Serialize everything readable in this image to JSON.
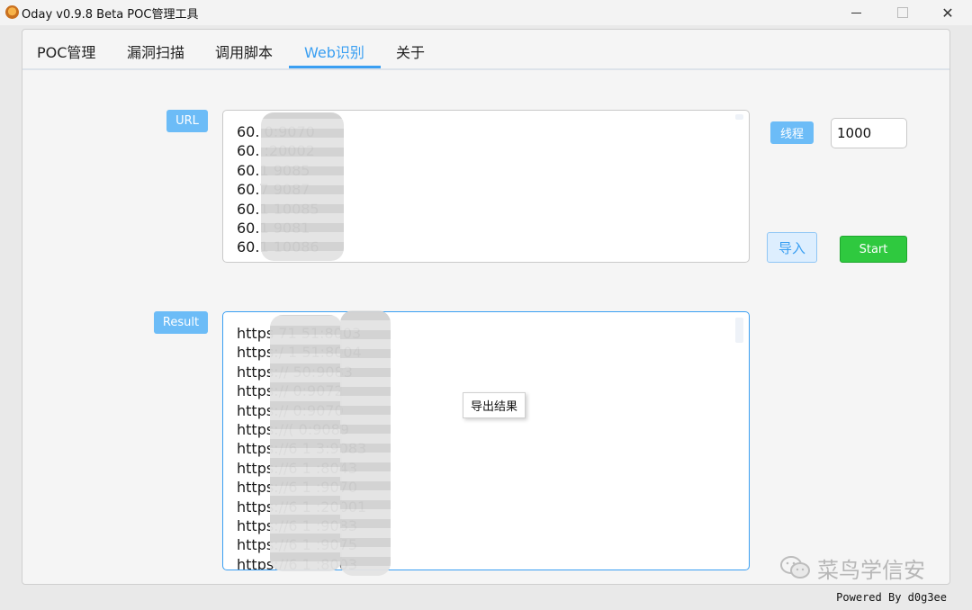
{
  "window": {
    "title": "Oday v0.9.8 Beta POC管理工具"
  },
  "tabs": [
    {
      "label": "POC管理"
    },
    {
      "label": "漏洞扫描"
    },
    {
      "label": "调用脚本"
    },
    {
      "label": "Web识别"
    },
    {
      "label": "关于"
    }
  ],
  "active_tab": "Web识别",
  "url_section": {
    "label": "URL",
    "lines": [
      "60.   0:9070",
      "60.   :20002",
      "60.1   9085",
      "60.7   9087",
      "60.1   10085",
      "60.1   9081",
      "60.1   10086"
    ]
  },
  "thread": {
    "label": "线程",
    "value": "1000"
  },
  "import_label": "导入",
  "start_label": "Start",
  "result_section": {
    "label": "Result",
    "lines": [
      "https   71   51:8003",
      "https:/   1   51:8004",
      "https://   50:9083",
      "https://   0:9072",
      "https://   0:9070",
      "https://(   0:9089",
      "https://6   1   3:9083",
      "https://6   1   :8043",
      "https://6   1   :9070",
      "https://6   1   :20001",
      "https://6   1   :9083",
      "https://6   1   :9075",
      "https://6   1   :8003"
    ]
  },
  "context_menu": {
    "item": "导出结果"
  },
  "footer": "Powered By d0g3ee",
  "watermark": "菜鸟学信安",
  "colors": {
    "accent": "#3a9ff2",
    "label_button": "#6cbcf7",
    "start_green": "#2fc93f"
  }
}
